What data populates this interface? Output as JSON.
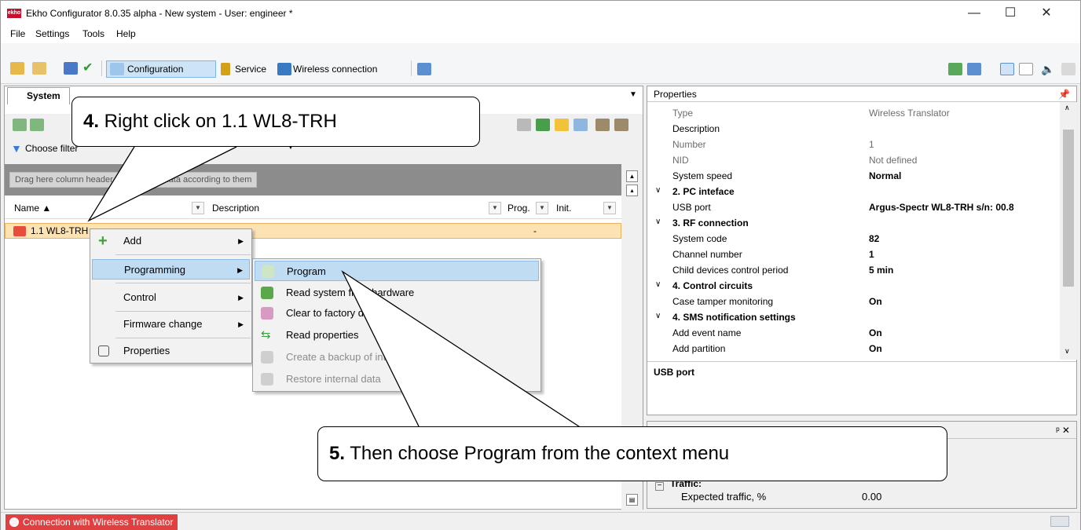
{
  "window": {
    "title": "Ekho Configurator 8.0.35 alpha - New system - User: engineer *",
    "logo_text": "ekho",
    "controls": {
      "minimize": "—",
      "maximize": "☐",
      "close": "✕"
    }
  },
  "menu": [
    "File",
    "Settings",
    "Tools",
    "Help"
  ],
  "toolbar": {
    "configuration": "Configuration",
    "service": "Service",
    "wireless": "Wireless connection"
  },
  "left": {
    "tab": "System",
    "filter": "Choose filter",
    "group_hint": "Drag here column header for grouping data according to them",
    "columns": {
      "name": "Name ▲",
      "description": "Description",
      "prog": "Prog.",
      "init": "Init."
    },
    "row": {
      "name": "1.1 WL8-TRH",
      "value": "-"
    }
  },
  "context_menu": {
    "items": [
      "Add",
      "Programming",
      "Control",
      "Firmware change",
      "Properties"
    ],
    "submenu": [
      "Program",
      "Read system from hardware",
      "Clear to factory defaults",
      "Read properties",
      "Create a backup of internal data",
      "Restore internal data"
    ]
  },
  "properties": {
    "title": "Properties",
    "rows": [
      {
        "key": "Type",
        "value": "Wireless Translator"
      },
      {
        "key": "Description",
        "value": ""
      },
      {
        "key": "Number",
        "value": "1"
      },
      {
        "key": "NID",
        "value": "Not defined"
      },
      {
        "key": "System speed",
        "value": "Normal"
      },
      {
        "key": "2. PC inteface",
        "value": ""
      },
      {
        "key": "USB port",
        "value": "Argus-Spectr WL8-TRH s/n: 00.8"
      },
      {
        "key": "3. RF connection",
        "value": ""
      },
      {
        "key": "System code",
        "value": "82"
      },
      {
        "key": "Channel number",
        "value": "1"
      },
      {
        "key": "Child devices control period",
        "value": "5 min"
      },
      {
        "key": "4. Control circuits",
        "value": ""
      },
      {
        "key": "Case tamper monitoring",
        "value": "On"
      },
      {
        "key": "4. SMS notification settings",
        "value": ""
      },
      {
        "key": "Add event name",
        "value": "On"
      },
      {
        "key": "Add partition",
        "value": "On"
      }
    ],
    "description": "USB port"
  },
  "stats": {
    "traffic_label": "Traffic:",
    "expected_traffic_label": "Expected traffic, %",
    "expected_traffic_value": "0.00"
  },
  "status": {
    "connection": "Connection with Wireless Translator"
  },
  "callouts": {
    "step4_num": "4.",
    "step4_text": " Right click on 1.1 WL8-TRH",
    "step5_num": "5.",
    "step5_text": " Then choose Program from the context menu"
  }
}
